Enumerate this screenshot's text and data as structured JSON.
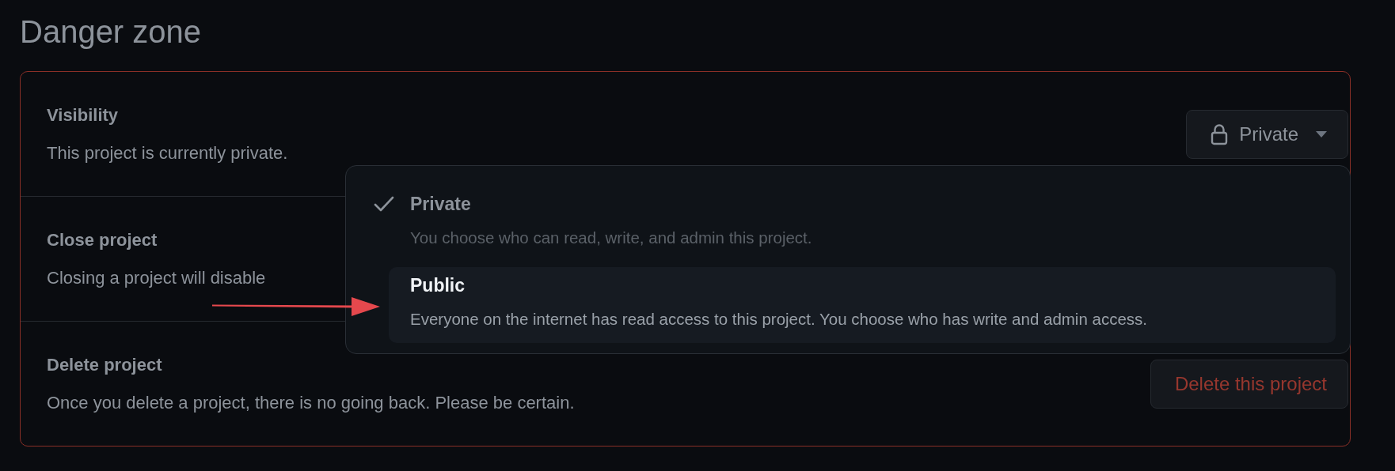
{
  "heading": "Danger zone",
  "settings": [
    {
      "title": "Visibility",
      "description": "This project is currently private.",
      "button": {
        "kind": "dropdown",
        "label": "Private"
      }
    },
    {
      "title": "Close project",
      "description": "Closing a project will disable"
    },
    {
      "title": "Delete project",
      "description": "Once you delete a project, there is no going back. Please be certain.",
      "button": {
        "kind": "danger",
        "label": "Delete this project"
      }
    }
  ],
  "visibility_menu": {
    "options": [
      {
        "label": "Private",
        "description": "You choose who can read, write, and admin this project.",
        "selected": true,
        "highlighted": false
      },
      {
        "label": "Public",
        "description": "Everyone on the internet has read access to this project. You choose who has write and admin access.",
        "selected": false,
        "highlighted": true
      }
    ]
  }
}
